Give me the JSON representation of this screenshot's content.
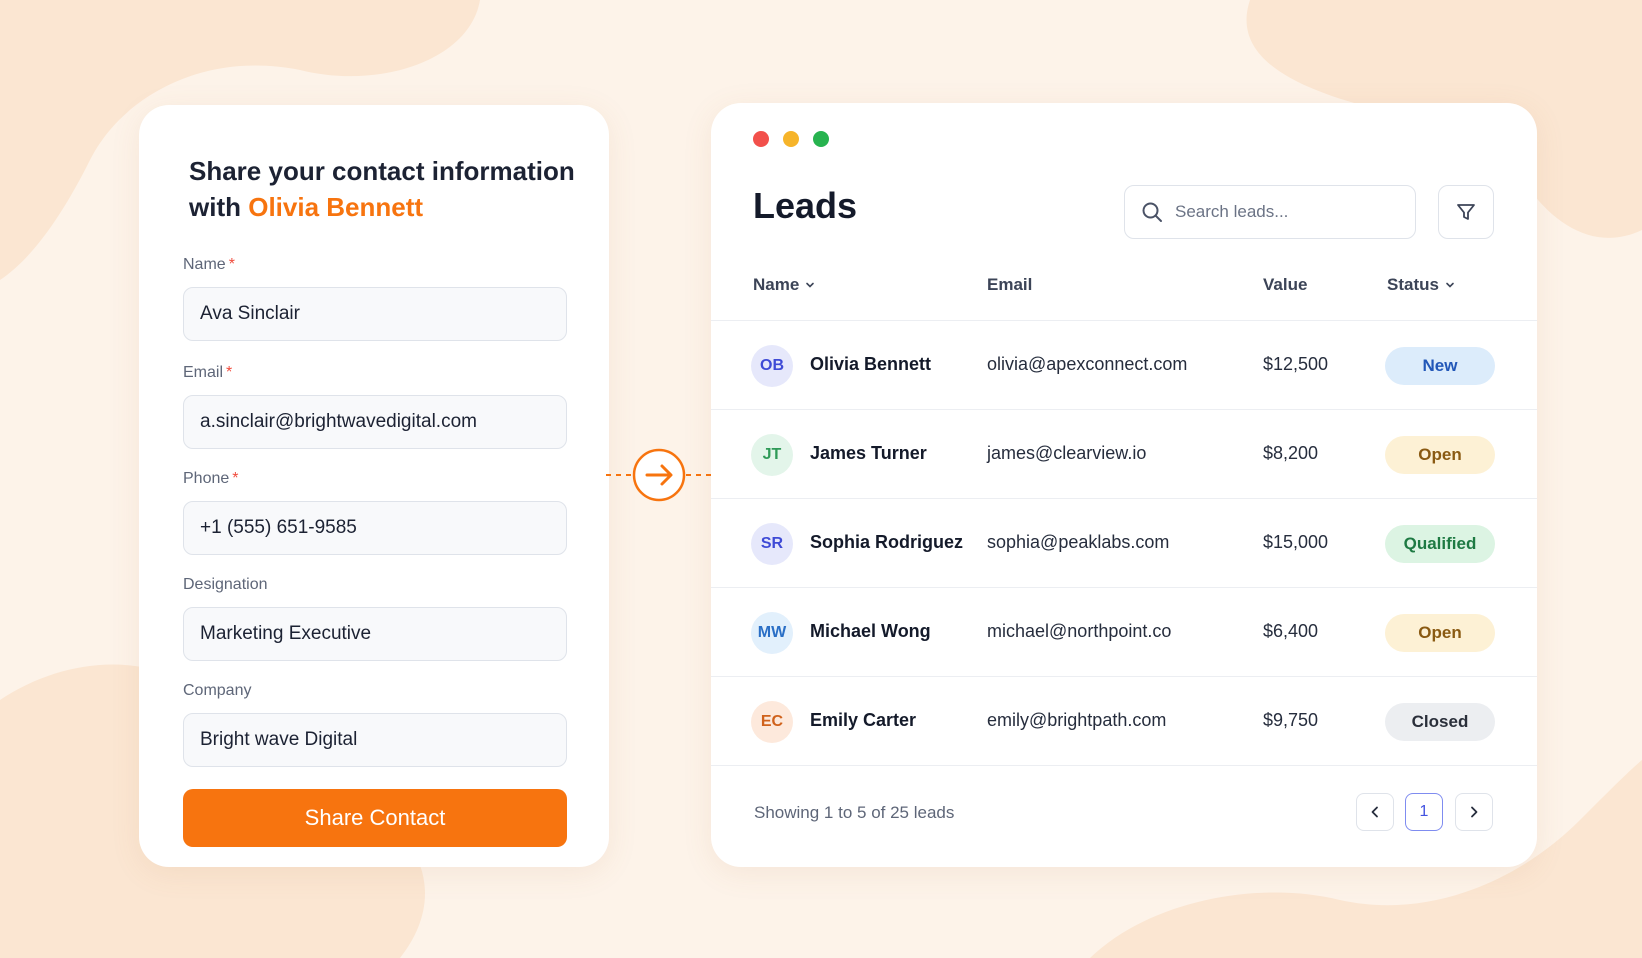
{
  "colors": {
    "background": "#fdf3e9",
    "accent": "#f7740f",
    "card": "#ffffff"
  },
  "form": {
    "title_line1": "Share your contact information",
    "title_prefix": "with ",
    "title_highlight": "Olivia Bennett",
    "fields": [
      {
        "label": "Name",
        "required": true,
        "value": "Ava Sinclair"
      },
      {
        "label": "Email",
        "required": true,
        "value": "a.sinclair@brightwavedigital.com"
      },
      {
        "label": "Phone",
        "required": true,
        "value": "+1 (555) 651-9585"
      },
      {
        "label": "Designation",
        "required": false,
        "value": "Marketing Executive"
      },
      {
        "label": "Company",
        "required": false,
        "value": "Bright wave Digital"
      }
    ],
    "required_mark": "*",
    "submit_label": "Share Contact"
  },
  "connector": {
    "icon": "arrow-right-circle-icon"
  },
  "leads": {
    "window_controls": [
      "close",
      "minimize",
      "maximize"
    ],
    "title": "Leads",
    "search": {
      "placeholder": "Search leads...",
      "value": "",
      "icon": "search-icon"
    },
    "filter_icon": "filter-icon",
    "columns": {
      "name": "Name",
      "email": "Email",
      "value": "Value",
      "status": "Status"
    },
    "rows": [
      {
        "initials": "OB",
        "name": "Olivia Bennett",
        "email": "olivia@apexconnect.com",
        "value": "$12,500",
        "status": "New",
        "avatar_bg": "#e6e8fb",
        "avatar_fg": "#3f4bd6",
        "badge_bg": "#dcecfb",
        "badge_fg": "#2257b8"
      },
      {
        "initials": "JT",
        "name": "James Turner",
        "email": "james@clearview.io",
        "value": "$8,200",
        "status": "Open",
        "avatar_bg": "#e3f5ea",
        "avatar_fg": "#2f9a58",
        "badge_bg": "#fdf1d5",
        "badge_fg": "#8a5a12"
      },
      {
        "initials": "SR",
        "name": "Sophia Rodriguez",
        "email": "sophia@peaklabs.com",
        "value": "$15,000",
        "status": "Qualified",
        "avatar_bg": "#e6e8fb",
        "avatar_fg": "#3f4bd6",
        "badge_bg": "#dcf4e3",
        "badge_fg": "#1e7a43"
      },
      {
        "initials": "MW",
        "name": "Michael Wong",
        "email": "michael@northpoint.co",
        "value": "$6,400",
        "status": "Open",
        "avatar_bg": "#e2f0fc",
        "avatar_fg": "#2a6fc6",
        "badge_bg": "#fdf1d5",
        "badge_fg": "#8a5a12"
      },
      {
        "initials": "EC",
        "name": "Emily Carter",
        "email": "emily@brightpath.com",
        "value": "$9,750",
        "status": "Closed",
        "avatar_bg": "#fde9dc",
        "avatar_fg": "#d0621c",
        "badge_bg": "#eceef1",
        "badge_fg": "#2a2f3a"
      }
    ],
    "footer": {
      "summary": "Showing 1 to 5 of 25 leads"
    },
    "pagination": {
      "current_page": "1",
      "prev_icon": "chevron-left-icon",
      "next_icon": "chevron-right-icon"
    }
  }
}
